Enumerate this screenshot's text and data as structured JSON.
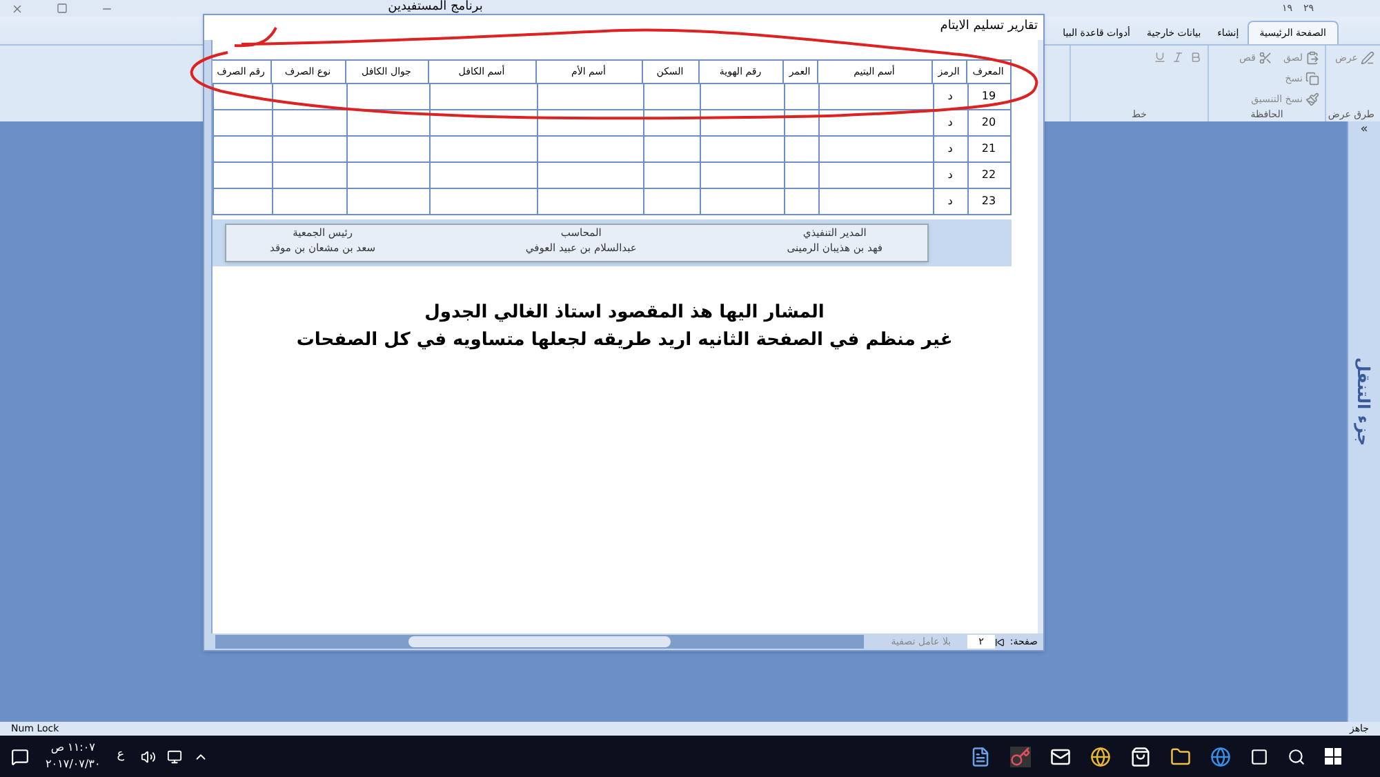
{
  "app_title": "برنامج المستفيدين",
  "quick_access": [
    "٢٩",
    "١٩"
  ],
  "ribbon_tabs": [
    {
      "label": "الصفحة الرئيسية",
      "selected": true
    },
    {
      "label": "إنشاء",
      "selected": false
    },
    {
      "label": "بيانات خارجية",
      "selected": false
    },
    {
      "label": "أدوات قاعدة البيا",
      "selected": false
    }
  ],
  "ribbon_groups": [
    {
      "label": "طرق عرض",
      "buttons": [
        "عرض"
      ]
    },
    {
      "label": "الحافظة",
      "buttons": [
        "لصق",
        "قص",
        "نسخ",
        "نسخ التنسيق"
      ]
    },
    {
      "label": "خط"
    }
  ],
  "navigation_pane": {
    "title": "جزء التنقل",
    "toggle": "«"
  },
  "report": {
    "title": "تقارير تسليم الايتام",
    "columns": [
      "المعرف",
      "الرمز",
      "أسم اليتيم",
      "العمر",
      "رقم الهوية",
      "السكن",
      "أسم الأم",
      "أسم الكافل",
      "جوال الكافل",
      "نوع الصرف",
      "رقم الصرف"
    ],
    "rows": [
      [
        "19",
        "د"
      ],
      [
        "20",
        "د"
      ],
      [
        "21",
        "د"
      ],
      [
        "22",
        "د"
      ],
      [
        "23",
        "د"
      ]
    ],
    "signatures": [
      {
        "role": "المدير التنفيذي",
        "name": "فهد بن هذيبان الرمينى"
      },
      {
        "role": "المحاسب",
        "name": "عبدالسلام بن عبيد العوفي"
      },
      {
        "role": "رئيس الجمعية",
        "name": "سعد بن مشعان بن موقد"
      }
    ],
    "page_label": "صفحة:",
    "page_number": "٢",
    "filter": "بلا عامل تصفية"
  },
  "message": [
    "المشار اليها هذ المقصود استاذ الغالي الجدول",
    "غير منظم في الصفحة الثانيه اريد طريقه لجعلها متساويه في كل الصفحات"
  ],
  "status_bar": {
    "left": "Num Lock",
    "right": "جاهز"
  },
  "taskbar": {
    "time": "١١:٠٧ ص",
    "date": "٢٠١٧/٠٧/٣٠",
    "language": "ع"
  }
}
